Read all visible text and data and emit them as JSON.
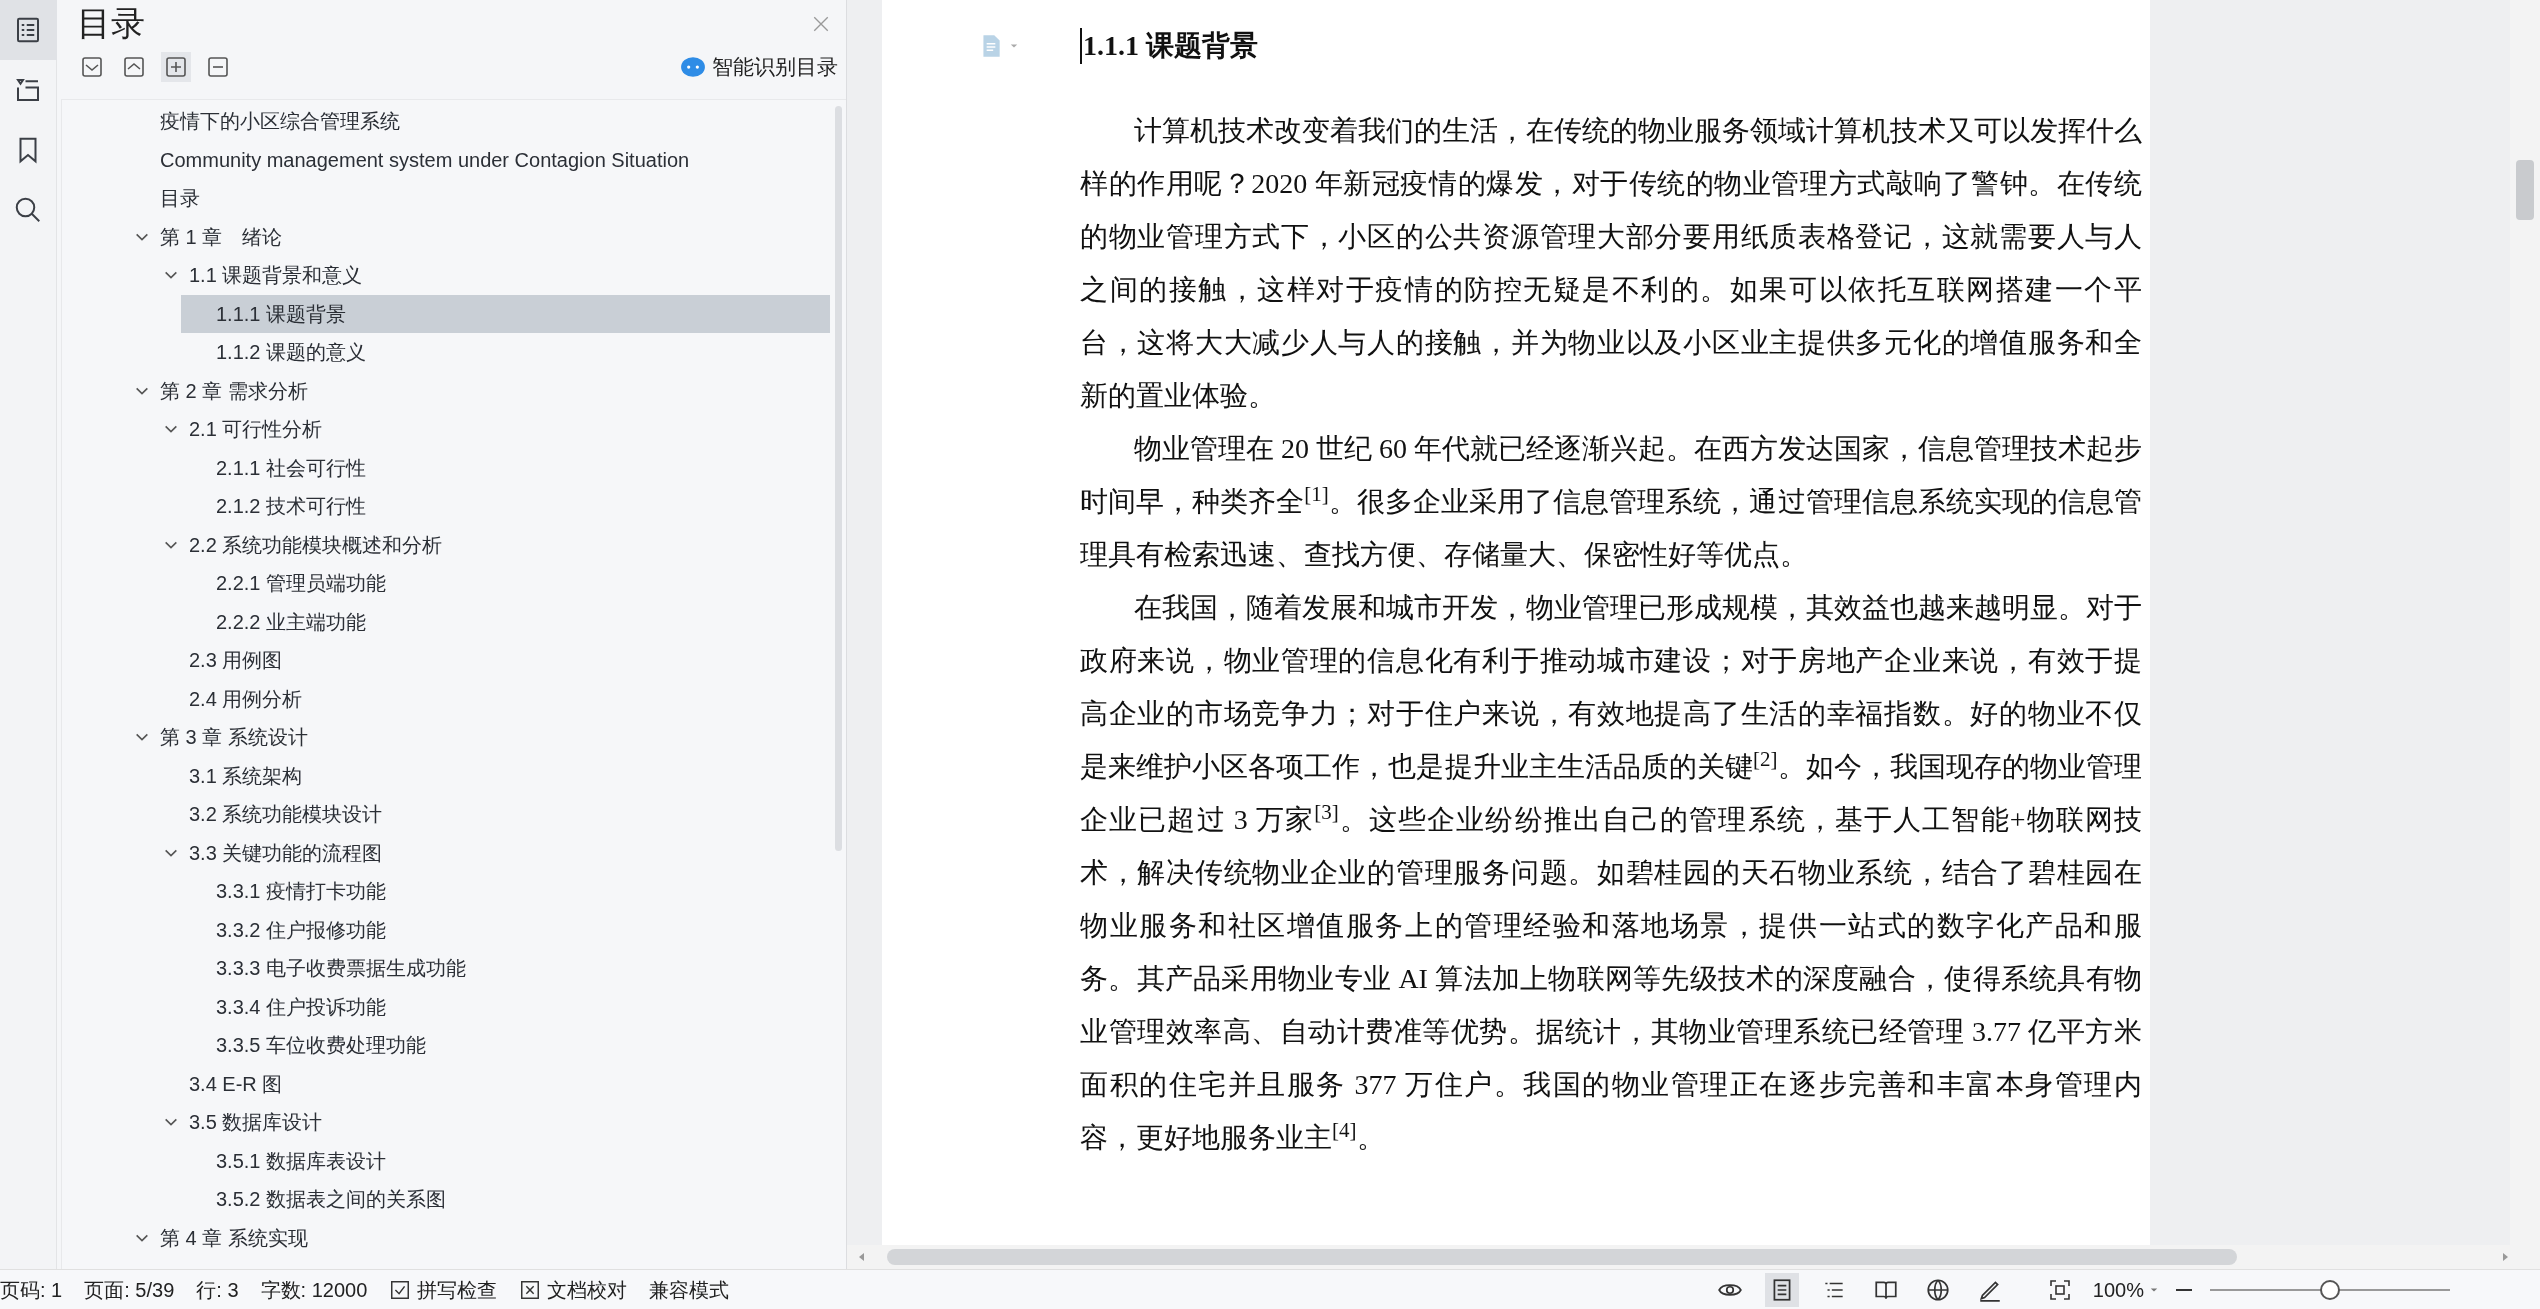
{
  "rail": [
    {
      "kind": "outline",
      "selected": true
    },
    {
      "kind": "tree",
      "selected": false
    },
    {
      "kind": "bookmark",
      "selected": false
    },
    {
      "kind": "search",
      "selected": false
    }
  ],
  "toc": {
    "title": "目录",
    "ai_button": "智能识别目录",
    "items": [
      {
        "label": "疫情下的小区综合管理系统",
        "selected": false
      },
      {
        "label": "Community management system under Contagion Situation",
        "selected": false
      },
      {
        "label": "目录",
        "selected": false
      },
      {
        "label": "第 1 章　绪论",
        "selected": false,
        "expanded": true,
        "children": [
          {
            "label": "1.1  课题背景和意义",
            "selected": false,
            "expanded": true,
            "children": [
              {
                "label": "1.1.1 课题背景",
                "selected": true
              },
              {
                "label": "1.1.2 课题的意义",
                "selected": false
              }
            ]
          }
        ]
      },
      {
        "label": "第 2 章  需求分析",
        "selected": false,
        "expanded": true,
        "children": [
          {
            "label": "2.1  可行性分析",
            "selected": false,
            "expanded": true,
            "children": [
              {
                "label": "2.1.1  社会可行性",
                "selected": false
              },
              {
                "label": "2.1.2  技术可行性",
                "selected": false
              }
            ]
          },
          {
            "label": "2.2  系统功能模块概述和分析",
            "selected": false,
            "expanded": true,
            "children": [
              {
                "label": "2.2.1 管理员端功能",
                "selected": false
              },
              {
                "label": "2.2.2 业主端功能",
                "selected": false
              }
            ]
          },
          {
            "label": "2.3  用例图",
            "selected": false
          },
          {
            "label": "2.4  用例分析",
            "selected": false
          }
        ]
      },
      {
        "label": "第 3 章  系统设计",
        "selected": false,
        "expanded": true,
        "children": [
          {
            "label": "3.1  系统架构",
            "selected": false
          },
          {
            "label": "3.2  系统功能模块设计",
            "selected": false
          },
          {
            "label": "3.3  关键功能的流程图",
            "selected": false,
            "expanded": true,
            "children": [
              {
                "label": "3.3.1  疫情打卡功能",
                "selected": false
              },
              {
                "label": "3.3.2  住户报修功能",
                "selected": false
              },
              {
                "label": "3.3.3  电子收费票据生成功能",
                "selected": false
              },
              {
                "label": "3.3.4  住户投诉功能",
                "selected": false
              },
              {
                "label": "3.3.5  车位收费处理功能",
                "selected": false
              }
            ]
          },
          {
            "label": "3.4 E-R 图",
            "selected": false
          },
          {
            "label": "3.5  数据库设计",
            "selected": false,
            "expanded": true,
            "children": [
              {
                "label": "3.5.1  数据库表设计",
                "selected": false
              },
              {
                "label": "3.5.2  数据表之间的关系图",
                "selected": false
              }
            ]
          }
        ]
      },
      {
        "label": "第 4 章  系统实现",
        "selected": false,
        "expanded": true
      }
    ]
  },
  "document": {
    "heading": "1.1.1 课题背景",
    "paragraphs": [
      "计算机技术改变着我们的生活，在传统的物业服务领域计算机技术又可以发挥什么样的作用呢？2020 年新冠疫情的爆发，对于传统的物业管理方式敲响了警钟。在传统的物业管理方式下，小区的公共资源管理大部分要用纸质表格登记，这就需要人与人之间的接触，这样对于疫情的防控无疑是不利的。如果可以依托互联网搭建一个平台，这将大大减少人与人的接触，并为物业以及小区业主提供多元化的增值服务和全新的置业体验。",
      "物业管理在 20 世纪 60 年代就已经逐渐兴起。在西方发达国家，信息管理技术起步时间早，种类齐全$^{[1]}$。很多企业采用了信息管理系统，通过管理信息系统实现的信息管理具有检索迅速、查找方便、存储量大、保密性好等优点。",
      "在我国，随着发展和城市开发，物业管理已形成规模，其效益也越来越明显。对于政府来说，物业管理的信息化有利于推动城市建设；对于房地产企业来说，有效于提高企业的市场竞争力；对于住户来说，有效地提高了生活的幸福指数。好的物业不仅是来维护小区各项工作，也是提升业主生活品质的关键$^{[2]}$。如今，我国现存的物业管理企业已超过 3 万家$^{[3]}$。这些企业纷纷推出自己的管理系统，基于人工智能+物联网技术，解决传统物业企业的管理服务问题。如碧桂园的天石物业系统，结合了碧桂园在物业服务和社区增值服务上的管理经验和落地场景，提供一站式的数字化产品和服务。其产品采用物业专业 AI 算法加上物联网等先级技术的深度融合，使得系统具有物业管理效率高、自动计费准等优势。据统计，其物业管理系统已经管理 3.77 亿平方米面积的住宅并且服务 377 万住户。我国的物业管理正在逐步完善和丰富本身管理内容，更好地服务业主$^{[4]}$。"
    ]
  },
  "status_bar": {
    "items": [
      {
        "kind": "text",
        "text": "页码: 1"
      },
      {
        "kind": "text",
        "text": "页面: 5/39"
      },
      {
        "kind": "text",
        "text": "行: 3"
      },
      {
        "kind": "text",
        "text": "字数: 12000"
      },
      {
        "kind": "check",
        "text": "拼写检查"
      },
      {
        "kind": "cross",
        "text": "文档校对"
      },
      {
        "kind": "text",
        "text": "兼容模式"
      }
    ],
    "views": [
      {
        "kind": "eye",
        "selected": false
      },
      {
        "kind": "page",
        "selected": true
      },
      {
        "kind": "outline",
        "selected": false
      },
      {
        "kind": "book",
        "selected": false
      },
      {
        "kind": "web",
        "selected": false
      },
      {
        "kind": "pen",
        "selected": false
      }
    ],
    "zoom": "100%",
    "zoom_slider": {
      "level": 0.5
    }
  }
}
